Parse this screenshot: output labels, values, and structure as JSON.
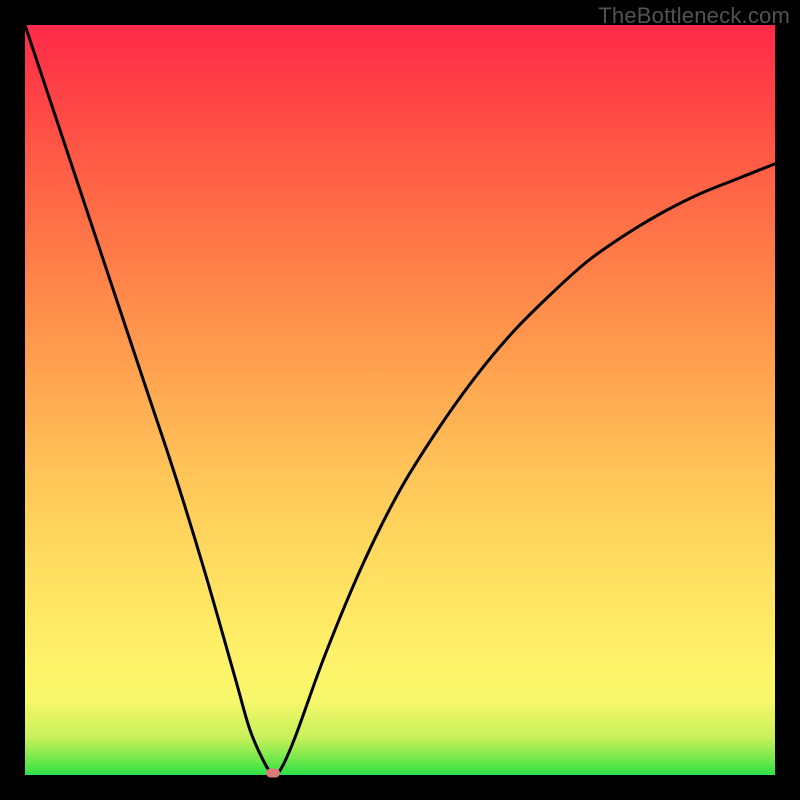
{
  "attribution": "TheBottleneck.com",
  "chart_data": {
    "type": "line",
    "title": "",
    "xlabel": "",
    "ylabel": "",
    "xlim": [
      0,
      100
    ],
    "ylim": [
      0,
      100
    ],
    "series": [
      {
        "name": "bottleneck-curve",
        "x": [
          0,
          4,
          8,
          12,
          16,
          20,
          24,
          28,
          30,
          32,
          33,
          34,
          36,
          40,
          45,
          50,
          55,
          60,
          65,
          70,
          75,
          80,
          85,
          90,
          95,
          100
        ],
        "values": [
          100,
          88,
          76,
          64,
          52,
          40,
          27,
          13,
          6,
          1.5,
          0.3,
          0.6,
          5,
          16,
          28,
          38,
          46,
          53,
          59,
          64,
          68.5,
          72,
          75,
          77.5,
          79.5,
          81.5
        ]
      }
    ],
    "annotations": [
      {
        "name": "minimum-marker",
        "x": 33,
        "y": 0.3
      }
    ],
    "background_gradient": {
      "bottom": "#2fe04a",
      "top": "#ff2a48"
    }
  }
}
